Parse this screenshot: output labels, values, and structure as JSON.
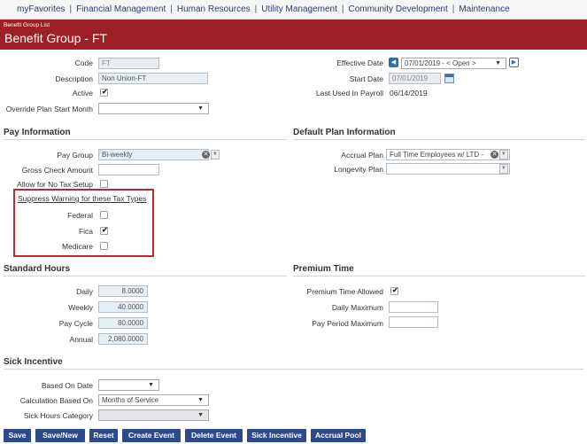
{
  "nav": {
    "items": [
      "myFavorites",
      "Financial Management",
      "Human Resources",
      "Utility Management",
      "Community Development",
      "Maintenance"
    ]
  },
  "header": {
    "breadcrumb": "Benefit Group List",
    "title": "Benefit Group - FT"
  },
  "general": {
    "code_label": "Code",
    "code_value": "FT",
    "description_label": "Description",
    "description_value": "Non Union-FT",
    "active_label": "Active",
    "active_checked": true,
    "override_label": "Override Plan Start Month",
    "override_value": "",
    "effective_date_label": "Effective Date",
    "effective_date_value": "07/01/2019 - < Open >",
    "start_date_label": "Start Date",
    "start_date_value": "07/01/2019",
    "last_used_label": "Last Used In Payroll",
    "last_used_value": "06/14/2019"
  },
  "pay_info": {
    "section_title": "Pay Information",
    "pay_group_label": "Pay Group",
    "pay_group_value": "Bi-weekly",
    "gross_check_label": "Gross Check Amount",
    "gross_check_value": "",
    "no_tax_label": "Allow for No Tax Setup",
    "no_tax_checked": false,
    "suppress_title": "Suppress Warning for these Tax Types",
    "federal_label": "Federal",
    "federal_checked": false,
    "fica_label": "Fica",
    "fica_checked": true,
    "medicare_label": "Medicare",
    "medicare_checked": false
  },
  "default_plan": {
    "section_title": "Default Plan Information",
    "accrual_label": "Accrual Plan",
    "accrual_value": "Full Time Employees w/ LTD -",
    "longevity_label": "Longevity Plan",
    "longevity_value": ""
  },
  "standard_hours": {
    "section_title": "Standard Hours",
    "daily_label": "Daily",
    "daily_value": "8.0000",
    "weekly_label": "Weekly",
    "weekly_value": "40.0000",
    "pay_cycle_label": "Pay Cycle",
    "pay_cycle_value": "80.0000",
    "annual_label": "Annual",
    "annual_value": "2,080.0000"
  },
  "premium_time": {
    "section_title": "Premium Time",
    "allowed_label": "Premium Time Allowed",
    "allowed_checked": true,
    "daily_max_label": "Daily Maximum",
    "daily_max_value": "",
    "pay_period_max_label": "Pay Period Maximum",
    "pay_period_max_value": ""
  },
  "sick": {
    "section_title": "Sick Incentive",
    "based_on_date_label": "Based On Date",
    "based_on_date_value": "",
    "calc_based_label": "Calculation Based On",
    "calc_based_value": "Months of Service",
    "sick_hours_label": "Sick Hours Category",
    "sick_hours_value": ""
  },
  "buttons": {
    "save": "Save",
    "save_new": "Save/New",
    "reset": "Reset",
    "create_event": "Create Event",
    "delete_event": "Delete Event",
    "sick_incentive": "Sick Incentive",
    "accrual_pool": "Accrual Pool"
  },
  "colors": {
    "header_bg": "#9c2026",
    "button_bg": "#2e4a8b",
    "highlight_box": "#c0282e"
  }
}
